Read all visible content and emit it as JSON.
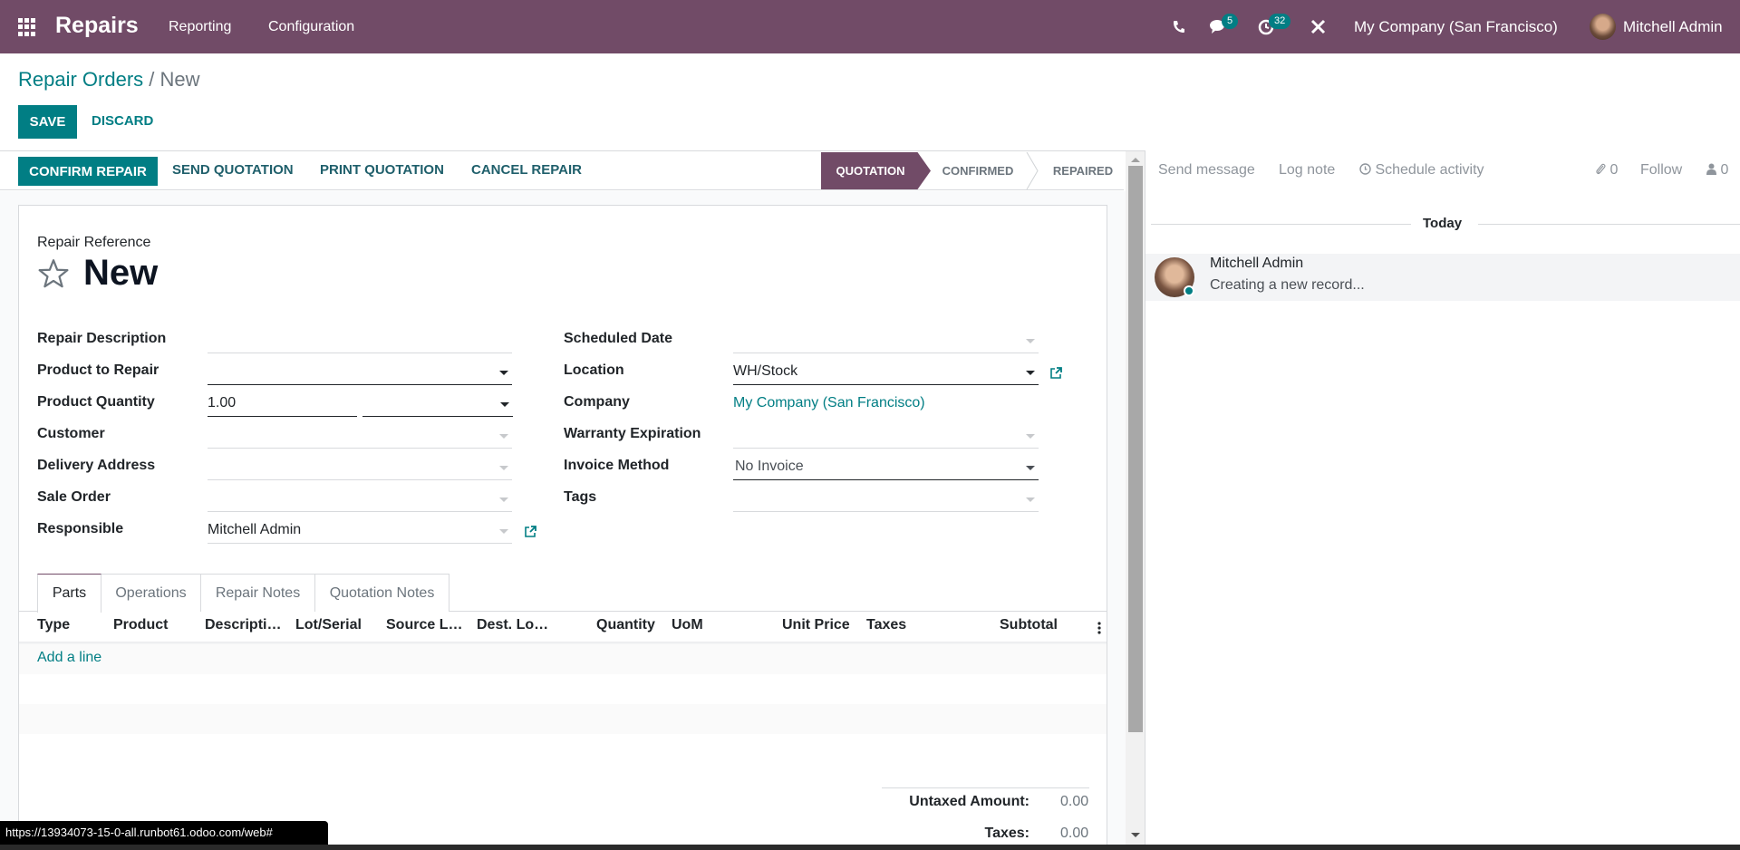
{
  "navbar": {
    "app_name": "Repairs",
    "menus": [
      "Reporting",
      "Configuration"
    ],
    "messages_badge": "5",
    "activities_badge": "32",
    "company": "My Company (San Francisco)",
    "user": "Mitchell Admin",
    "brand_color": "#714B67"
  },
  "breadcrumb": {
    "parent": "Repair Orders",
    "separator": "/",
    "current": "New"
  },
  "control": {
    "save_label": "SAVE",
    "discard_label": "DISCARD"
  },
  "statusbar": {
    "buttons": [
      "CONFIRM REPAIR",
      "SEND QUOTATION",
      "PRINT QUOTATION",
      "CANCEL REPAIR"
    ],
    "stages": [
      "QUOTATION",
      "CONFIRMED",
      "REPAIRED"
    ],
    "active_stage": "QUOTATION"
  },
  "form": {
    "reference_label": "Repair Reference",
    "reference_value": "New",
    "left_fields": [
      {
        "label": "Repair Description",
        "value": ""
      },
      {
        "label": "Product to Repair",
        "value": ""
      },
      {
        "label": "Product Quantity",
        "value": "1.00",
        "uom": ""
      },
      {
        "label": "Customer",
        "value": ""
      },
      {
        "label": "Delivery Address",
        "value": ""
      },
      {
        "label": "Sale Order",
        "value": ""
      },
      {
        "label": "Responsible",
        "value": "Mitchell Admin"
      }
    ],
    "right_fields": [
      {
        "label": "Scheduled Date",
        "value": ""
      },
      {
        "label": "Location",
        "value": "WH/Stock"
      },
      {
        "label": "Company",
        "value": "My Company (San Francisco)"
      },
      {
        "label": "Warranty Expiration",
        "value": ""
      },
      {
        "label": "Invoice Method",
        "value": "No Invoice"
      },
      {
        "label": "Tags",
        "value": ""
      }
    ],
    "tabs": [
      "Parts",
      "Operations",
      "Repair Notes",
      "Quotation Notes"
    ],
    "active_tab": "Parts",
    "columns": [
      "Type",
      "Product",
      "Descripti…",
      "Lot/Serial",
      "Source L…",
      "Dest. Lo…",
      "Quantity",
      "UoM",
      "Unit Price",
      "Taxes",
      "Subtotal"
    ],
    "add_line": "Add a line",
    "totals": [
      {
        "label": "Untaxed Amount:",
        "value": "0.00"
      },
      {
        "label": "Taxes:",
        "value": "0.00"
      }
    ]
  },
  "chatter": {
    "send_message": "Send message",
    "log_note": "Log note",
    "schedule_activity": "Schedule activity",
    "attachments_count": "0",
    "follow": "Follow",
    "followers_count": "0",
    "date_separator": "Today",
    "messages": [
      {
        "author": "Mitchell Admin",
        "body": "Creating a new record..."
      }
    ]
  },
  "status_url": "https://13934073-15-0-all.runbot61.odoo.com/web#"
}
